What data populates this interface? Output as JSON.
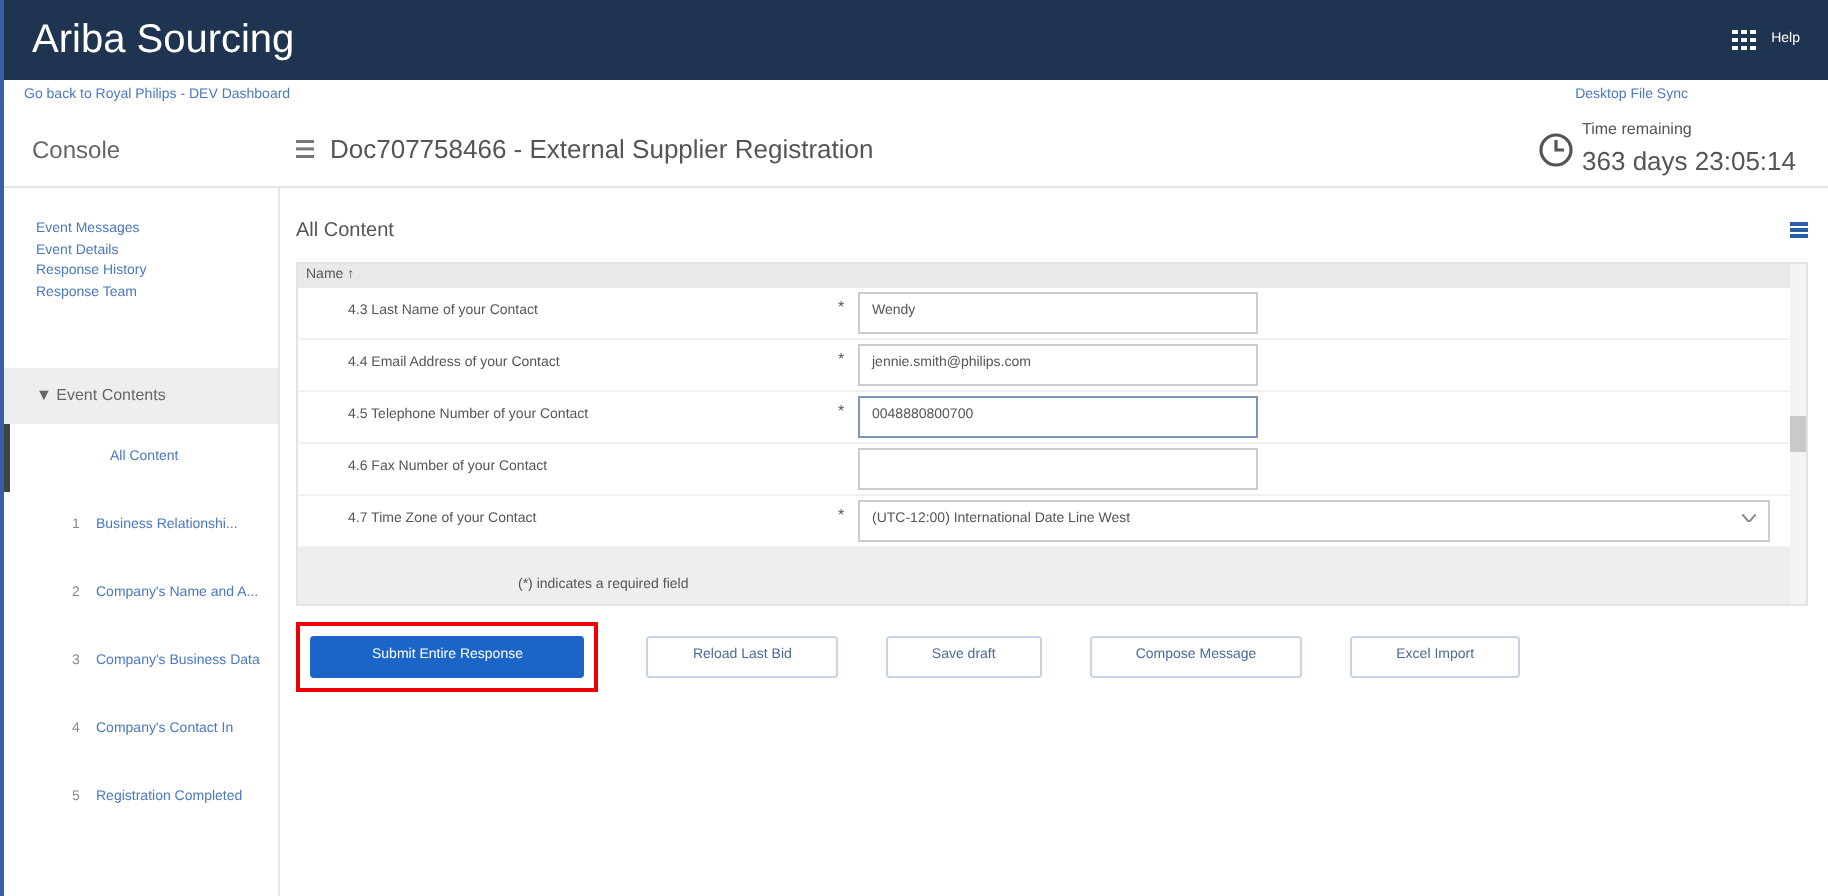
{
  "app_bar": {
    "title": "Ariba Sourcing",
    "help": "Help"
  },
  "back_link": "Go back to Royal Philips - DEV Dashboard",
  "sync_link": "Desktop File Sync",
  "console": "Console",
  "document_title": "Doc707758466 - External Supplier Registration",
  "timer": {
    "label": "Time remaining",
    "value": "363 days 23:05:14"
  },
  "sidebar": {
    "links": [
      "Event Messages",
      "Event Details",
      "Response History",
      "Response Team"
    ],
    "contents_header": "▼ Event Contents",
    "items": [
      {
        "label": "All Content",
        "selected": true
      },
      {
        "number": "1",
        "label": "Business Relationshi...",
        "selected": false
      },
      {
        "number": "2",
        "label": "Company's Name and A...",
        "selected": false
      },
      {
        "number": "3",
        "label": "Company's Business Data",
        "selected": false
      },
      {
        "number": "4",
        "label": "Company's Contact In",
        "selected": false
      },
      {
        "number": "5",
        "label": "Registration Completed",
        "selected": false
      }
    ]
  },
  "section_title": "All Content",
  "table": {
    "column": "Name ↑",
    "rows": [
      {
        "label": "4.3  Last Name of your Contact",
        "required_mark": "*",
        "kind": "text",
        "value": "Wendy",
        "focused": false
      },
      {
        "label": "4.4  Email Address of your Contact",
        "required_mark": "*",
        "kind": "text",
        "value": "jennie.smith@philips.com",
        "focused": false
      },
      {
        "label": "4.5  Telephone Number of your Contact",
        "required_mark": "*",
        "kind": "text",
        "value": "0048880800700",
        "focused": true
      },
      {
        "label": "4.6  Fax Number of your Contact",
        "kind": "text",
        "focused": false
      },
      {
        "label": "4.7  Time Zone of your Contact",
        "required_mark": "*",
        "kind": "select",
        "value": "(UTC-12:00) International Date Line West",
        "focused": false
      }
    ],
    "footnote": "(*) indicates a required field"
  },
  "buttons": [
    {
      "label": "Submit Entire Response",
      "primary": true,
      "highlighted": true
    },
    {
      "label": "Reload Last Bid",
      "primary": false,
      "highlighted": false
    },
    {
      "label": "Save draft",
      "primary": false,
      "highlighted": false
    },
    {
      "label": "Compose Message",
      "primary": false,
      "highlighted": false
    },
    {
      "label": "Excel Import",
      "primary": false,
      "highlighted": false
    }
  ]
}
